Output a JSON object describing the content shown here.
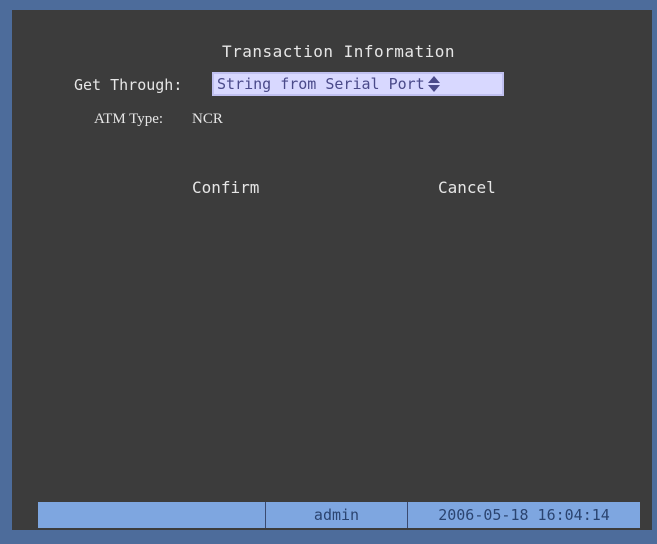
{
  "dialog": {
    "title": "Transaction Information",
    "get_through_label": "Get Through:",
    "get_through_value": "String from Serial Port",
    "atm_type_label": "ATM Type:",
    "atm_type_value": "NCR"
  },
  "buttons": {
    "confirm": "Confirm",
    "cancel": "Cancel"
  },
  "status_bar": {
    "left": "",
    "user": "admin",
    "datetime": "2006-05-18 16:04:14"
  },
  "colors": {
    "background": "#3c3c3c",
    "selection": "#d8d8ff",
    "status_bar": "#7ea6e0"
  }
}
